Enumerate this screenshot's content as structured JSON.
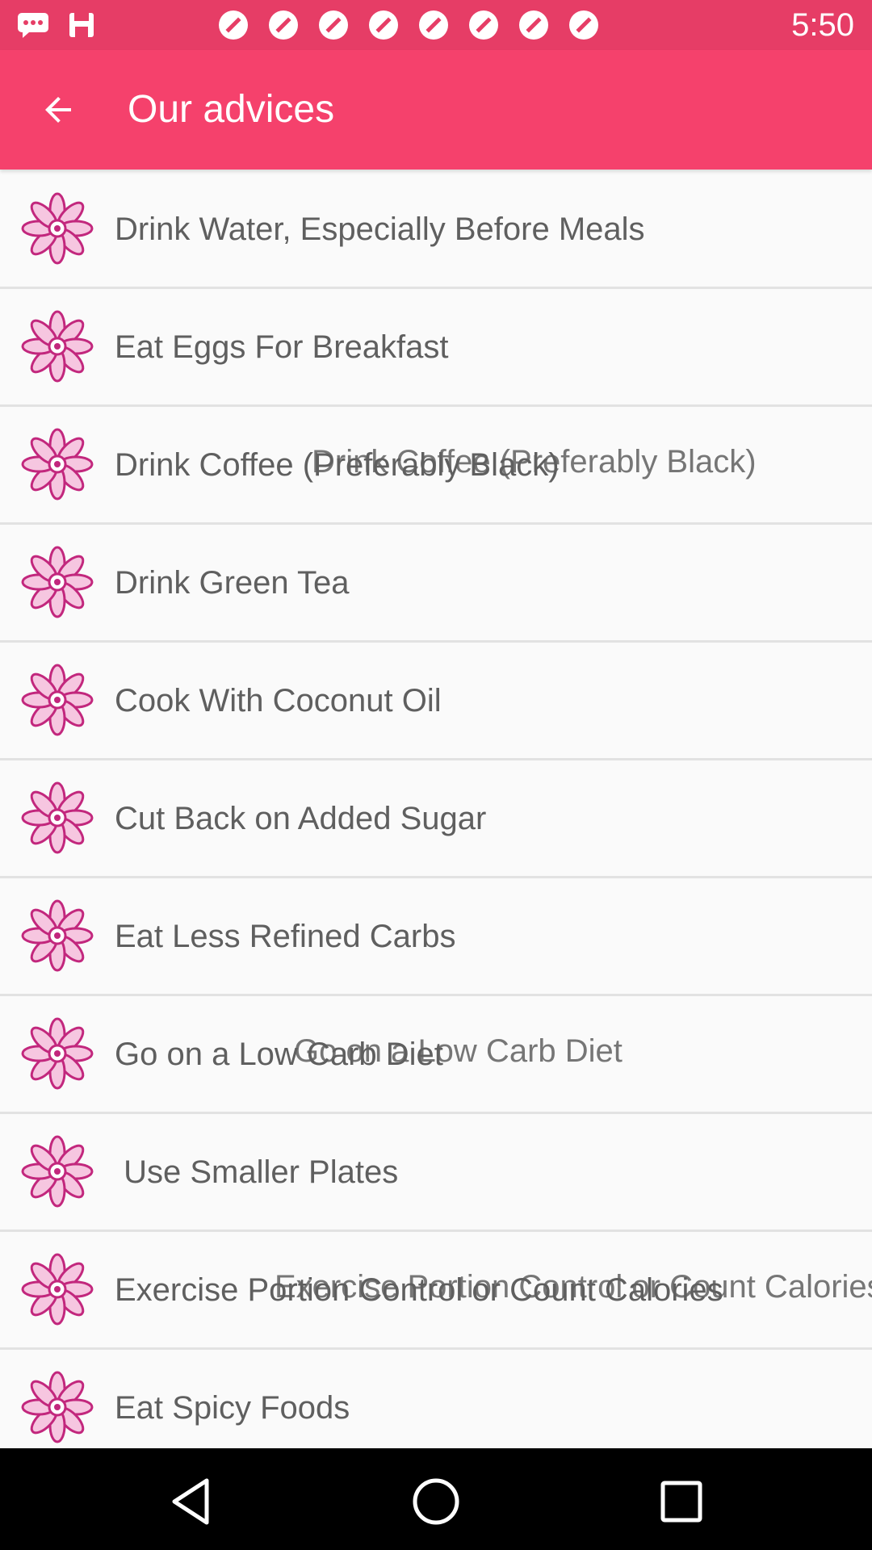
{
  "status_bar": {
    "time": "5:50",
    "icons": [
      "chat-bubble-icon",
      "save-icon",
      "no-entry-icon",
      "no-entry-icon",
      "no-entry-icon",
      "no-entry-icon",
      "no-entry-icon",
      "no-entry-icon",
      "no-entry-icon",
      "no-entry-icon",
      "no-entry-icon",
      "no-entry-icon"
    ]
  },
  "app_bar": {
    "back_icon": "arrow-back-icon",
    "title": "Our advices"
  },
  "colors": {
    "status_bar": "#e63d66",
    "app_bar": "#f5416c",
    "item_text": "#5f5f5f",
    "flower_icon": "#c2277d"
  },
  "advices": [
    "Drink Water, Especially Before Meals",
    "Eat Eggs For Breakfast",
    "Drink Coffee (Preferably Black)",
    "Drink Green Tea",
    "Cook With Coconut Oil",
    "Cut Back on Added Sugar",
    "Eat Less Refined Carbs",
    "Go on a Low Carb Diet",
    " Use Smaller Plates",
    "Exercise Portion Control or Count Calories",
    "Eat Spicy Foods"
  ],
  "ghost_labels": {
    "2": "Drink Coffee (Preferably Black)",
    "7": "Go on a Low Carb Diet",
    "9": "Exercise Portion Control or Count Calories"
  },
  "nav_bar": {
    "back": "nav-back-icon",
    "home": "nav-home-icon",
    "recents": "nav-recents-icon"
  }
}
